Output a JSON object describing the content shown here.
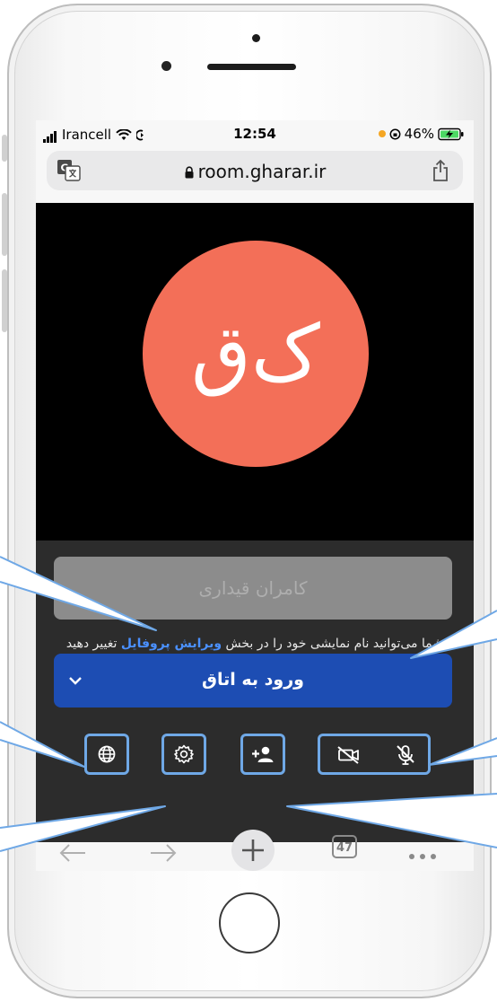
{
  "status_bar": {
    "carrier": "Irancell",
    "time": "12:54",
    "battery": "46%"
  },
  "browser": {
    "url": "room.gharar.ir",
    "tab_count": "47"
  },
  "profile": {
    "initials": "ک‌ق"
  },
  "name_field": {
    "placeholder": "کامران قیداری"
  },
  "hint": {
    "prefix": "شما می‌توانید نام نمایشی خود را در بخش ",
    "link": "ویرایش پروفایل",
    "suffix": " تغییر دهید"
  },
  "join_button": {
    "label": "ورود به اتاق"
  },
  "colors": {
    "avatar": "#f36f58",
    "join": "#1d4db3",
    "link": "#4a90ff",
    "highlight": "#6fa8e6"
  },
  "icons": [
    "language-icon",
    "settings-icon",
    "add-person-icon",
    "camera-off-icon",
    "mic-off-icon"
  ]
}
